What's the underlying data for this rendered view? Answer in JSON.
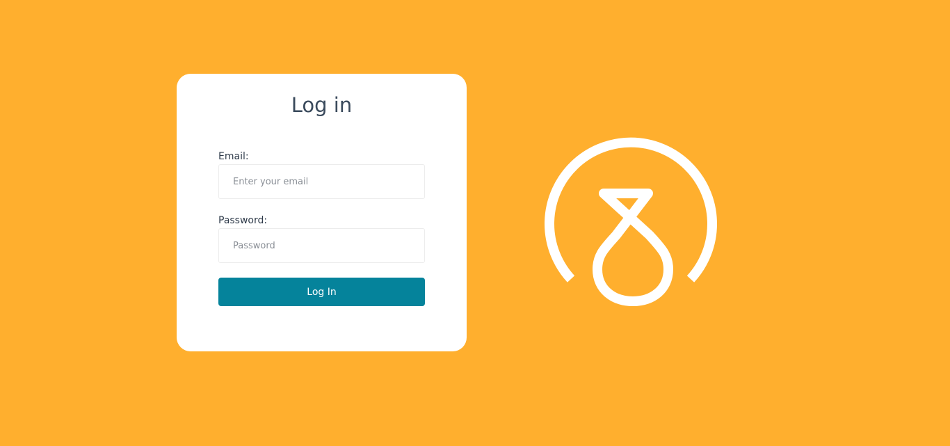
{
  "login": {
    "title": "Log in",
    "email_label": "Email:",
    "email_placeholder": "Enter your email",
    "email_value": "",
    "password_label": "Password:",
    "password_placeholder": "Password",
    "password_value": "",
    "submit_label": "Log In"
  },
  "brand": {
    "logo_icon": "circle-figure-eight-logo-icon"
  },
  "colors": {
    "background": "#FFAF2E",
    "card": "#FFFFFF",
    "button": "#05839B",
    "button_text": "#FFFFFF",
    "title_text": "#3A4A5C",
    "logo": "#FFFFFF"
  }
}
